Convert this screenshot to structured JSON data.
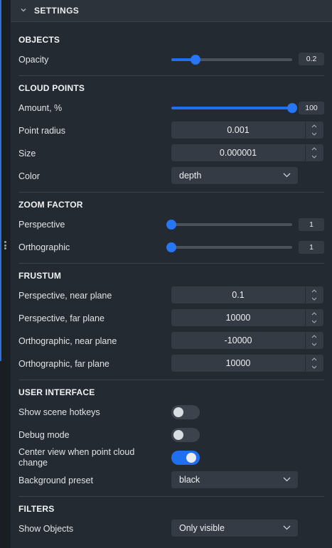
{
  "panel": {
    "title": "SETTINGS"
  },
  "objects": {
    "title": "OBJECTS",
    "opacity": {
      "label": "Opacity",
      "value": "0.2",
      "fraction": 0.2
    }
  },
  "cloud_points": {
    "title": "CLOUD POINTS",
    "amount": {
      "label": "Amount, %",
      "value": "100",
      "fraction": 1.0
    },
    "point_radius": {
      "label": "Point radius",
      "value": "0.001"
    },
    "size": {
      "label": "Size",
      "value": "0.000001"
    },
    "color": {
      "label": "Color",
      "value": "depth"
    }
  },
  "zoom_factor": {
    "title": "ZOOM FACTOR",
    "perspective": {
      "label": "Perspective",
      "value": "1",
      "fraction": 0.0
    },
    "orthographic": {
      "label": "Orthographic",
      "value": "1",
      "fraction": 0.0
    }
  },
  "frustum": {
    "title": "FRUSTUM",
    "persp_near": {
      "label": "Perspective, near plane",
      "value": "0.1"
    },
    "persp_far": {
      "label": "Perspective, far plane",
      "value": "10000"
    },
    "ortho_near": {
      "label": "Orthographic, near plane",
      "value": "-10000"
    },
    "ortho_far": {
      "label": "Orthographic, far plane",
      "value": "10000"
    }
  },
  "user_interface": {
    "title": "USER INTERFACE",
    "show_hotkeys": {
      "label": "Show scene hotkeys",
      "on": false
    },
    "debug_mode": {
      "label": "Debug mode",
      "on": false
    },
    "center_view": {
      "label_line1": "Center view when point cloud",
      "label_line2": "change",
      "on": true
    },
    "background_preset": {
      "label": "Background preset",
      "value": "black"
    }
  },
  "filters": {
    "title": "FILTERS",
    "show_objects": {
      "label": "Show Objects",
      "value": "Only visible"
    }
  },
  "colors": {
    "accent": "#1f6ff0",
    "panel_bg": "#242a31",
    "control_bg": "#343b44"
  }
}
